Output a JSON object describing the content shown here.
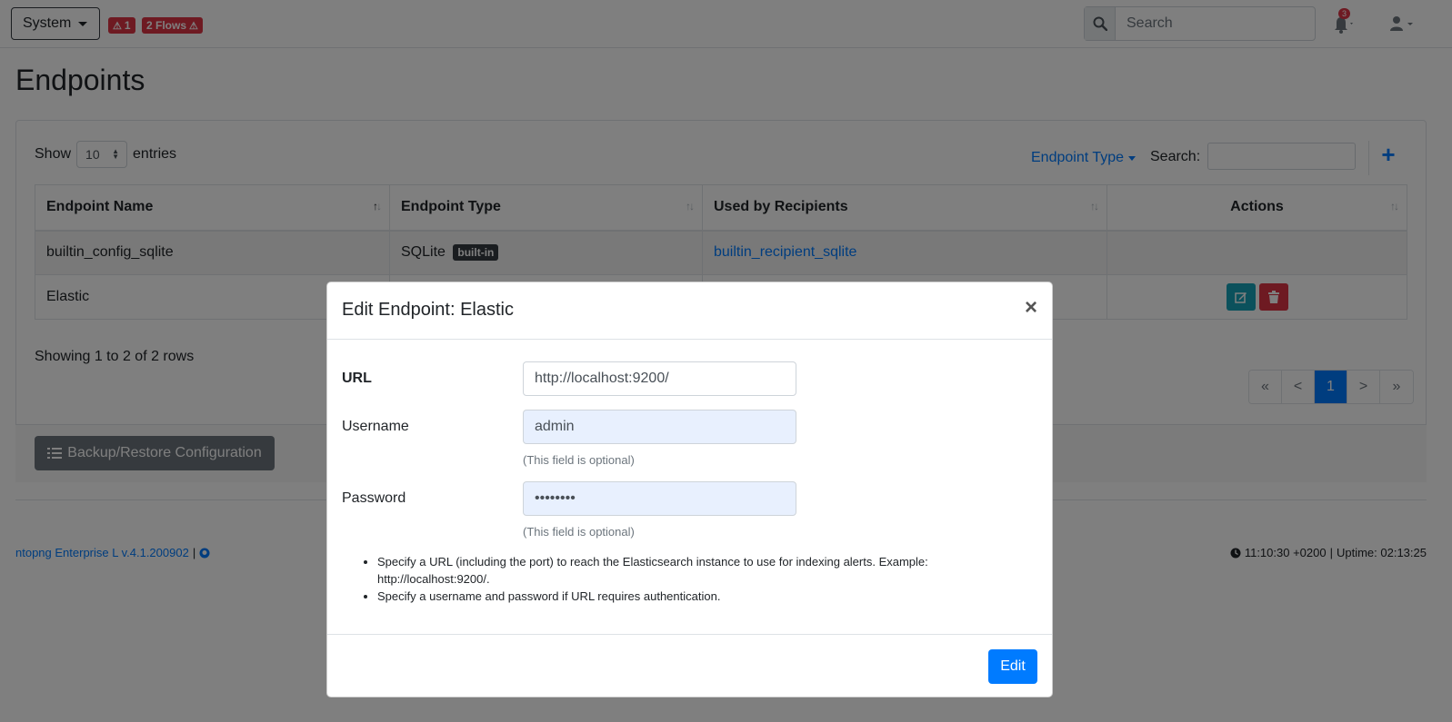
{
  "navbar": {
    "system_label": "System",
    "alerts_count": "1",
    "flows_label": "2 Flows",
    "search_placeholder": "Search",
    "notifications_count": "3"
  },
  "page": {
    "title": "Endpoints"
  },
  "table_controls": {
    "show_label": "Show",
    "entries_value": "10",
    "entries_label": "entries",
    "endpoint_type_filter": "Endpoint Type",
    "search_label": "Search:"
  },
  "table": {
    "headers": [
      "Endpoint Name",
      "Endpoint Type",
      "Used by Recipients",
      "Actions"
    ],
    "rows": [
      {
        "name": "builtin_config_sqlite",
        "type": "SQLite",
        "badge": "built-in",
        "recipients": "builtin_recipient_sqlite"
      },
      {
        "name": "Elastic",
        "type": "",
        "badge": "",
        "recipients": ""
      }
    ],
    "showing_text": "Showing 1 to 2 of 2 rows",
    "pagination": [
      "«",
      "<",
      "1",
      ">",
      "»"
    ],
    "active_page": "1"
  },
  "backup_button": "Backup/Restore Configuration",
  "footer": {
    "version": "ntopng Enterprise L v.4.1.200902",
    "time": "11:10:30 +0200",
    "uptime": "Uptime: 02:13:25"
  },
  "modal": {
    "title": "Edit Endpoint: Elastic",
    "close": "×",
    "url_label": "URL",
    "url_value": "http://localhost:9200/",
    "username_label": "Username",
    "username_value": "admin",
    "username_help": "(This field is optional)",
    "password_label": "Password",
    "password_value": "••••••••",
    "password_help": "(This field is optional)",
    "notes": [
      "Specify a URL (including the port) to reach the Elasticsearch instance to use for indexing alerts. Example: http://localhost:9200/.",
      "Specify a username and password if URL requires authentication."
    ],
    "edit_button": "Edit"
  },
  "colors": {
    "primary": "#007bff",
    "danger": "#dc3545",
    "info": "#17a2b8",
    "secondary": "#6c757d"
  },
  "icons": {
    "search": "search-icon",
    "bell": "bell-icon",
    "user": "user-icon",
    "warning": "warning-icon",
    "edit": "edit-icon",
    "trash": "trash-icon",
    "list": "list-icon",
    "clock": "clock-icon",
    "github": "github-icon",
    "plus": "plus-icon"
  }
}
